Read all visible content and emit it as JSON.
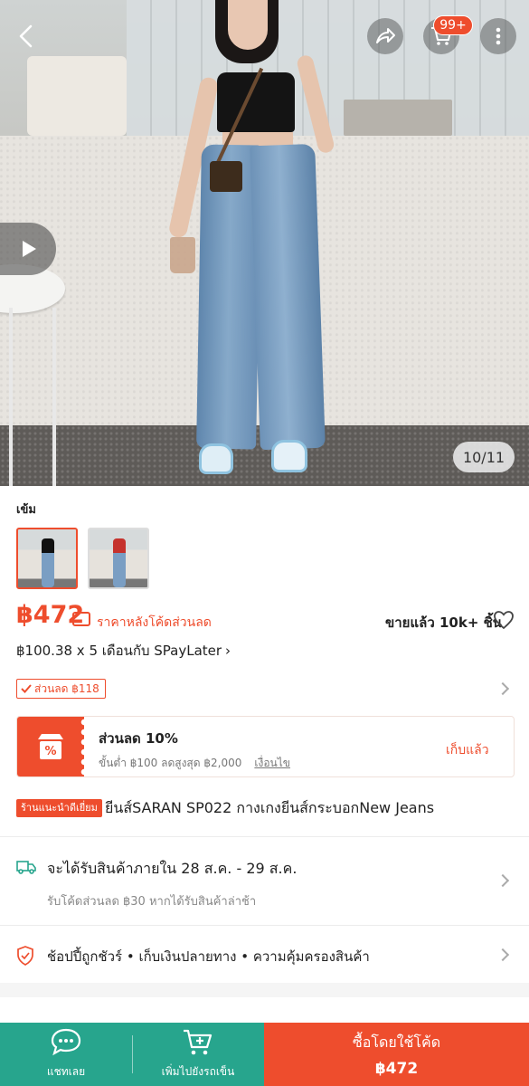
{
  "gallery": {
    "page_indicator": "10/11"
  },
  "header": {
    "cart_badge": "99+"
  },
  "variant": {
    "label": "เข้ม"
  },
  "price": {
    "amount": "฿472",
    "note": "ราคาหลังโค้ดส่วนลด",
    "sold": "ขายแล้ว 10k+ ชิ้น",
    "installment": "฿100.38 x 5 เดือนกับ SPayLater"
  },
  "discount_tag": "ส่วนลด ฿118",
  "voucher": {
    "title": "ส่วนลด 10%",
    "subtitle": "ขั้นต่ำ ฿100 ลดสูงสุด ฿2,000",
    "conditions": "เงื่อนไข",
    "claim": "เก็บแล้ว"
  },
  "product": {
    "badge": "ร้านแนะนำดีเยี่ยม",
    "title": "ยีนส์SARAN SP022 กางเกงยีนส์กระบอกNew Jeans"
  },
  "shipping": {
    "main": "จะได้รับสินค้าภายใน 28 ส.ค. - 29 ส.ค.",
    "sub": "รับโค้ดส่วนลด ฿30 หากได้รับสินค้าล่าช้า"
  },
  "guarantee": {
    "text": "ช้อปปี้ถูกชัวร์ • เก็บเงินปลายทาง • ความคุ้มครองสินค้า"
  },
  "bottom_bar": {
    "chat_label": "แชทเลย",
    "cart_label": "เพิ่มไปยังรถเข็น",
    "buy_label": "ซื้อโดยใช้โค้ด",
    "buy_price": "฿472"
  },
  "colors": {
    "accent": "#ee4d2d",
    "bottom_green": "#27a58d"
  },
  "icons": [
    "back-icon",
    "share-icon",
    "cart-icon",
    "more-icon",
    "play-icon",
    "voucher-icon",
    "heart-icon",
    "check-icon",
    "percent-voucher-icon",
    "truck-icon",
    "shield-icon",
    "chat-icon",
    "add-cart-icon",
    "chevron-right-icon"
  ]
}
